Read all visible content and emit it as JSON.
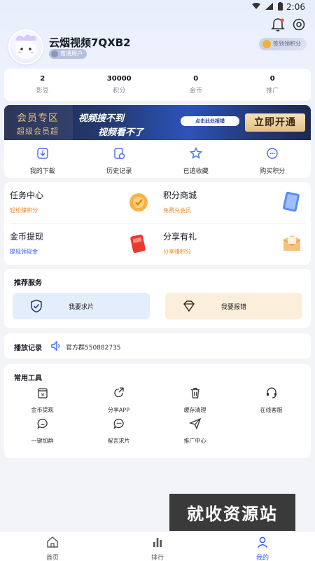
{
  "status_bar": {
    "time": "2:06"
  },
  "profile": {
    "username": "云烟视频7QXB2",
    "user_badge": "普通用户",
    "signin_label": "签到领积分"
  },
  "stats": [
    {
      "value": "2",
      "label": "影豆"
    },
    {
      "value": "30000",
      "label": "积分"
    },
    {
      "value": "0",
      "label": "金币"
    },
    {
      "value": "0",
      "label": "推广"
    }
  ],
  "vip_banner": {
    "zone_title": "会员专区",
    "zone_subtitle": "超级会员超",
    "slogan_1": "视频搜不到",
    "slogan_2": "视频看不了",
    "report_pill": "点击此处报错",
    "open_button": "立即开通"
  },
  "quick_actions": [
    {
      "label": "我的下载",
      "icon": "download-icon"
    },
    {
      "label": "历史记录",
      "icon": "history-icon"
    },
    {
      "label": "已追收藏",
      "icon": "star-icon"
    },
    {
      "label": "购买积分",
      "icon": "coin-icon"
    }
  ],
  "tasks": [
    {
      "title": "任务中心",
      "subtitle": "轻松赚积分",
      "icon": "task-center-icon",
      "color": "#f08a24"
    },
    {
      "title": "积分商城",
      "subtitle": "免费兑会员",
      "icon": "points-mall-icon",
      "color": "#f08a24"
    },
    {
      "title": "金币提现",
      "subtitle": "提现领现金",
      "icon": "coin-withdraw-icon",
      "color": "#2d5bf0"
    },
    {
      "title": "分享有礼",
      "subtitle": "分享赚积分",
      "icon": "share-gift-icon",
      "color": "#f08a24"
    }
  ],
  "recommend": {
    "title": "推荐服务",
    "request_label": "我要求片",
    "report_label": "我要报错"
  },
  "play_record": {
    "title": "播放记录",
    "group": "官方群550882735"
  },
  "tools": {
    "title": "常用工具",
    "items": [
      {
        "label": "金币提现",
        "icon": "wallet-icon"
      },
      {
        "label": "分享APP",
        "icon": "share-icon"
      },
      {
        "label": "缓存清理",
        "icon": "trash-icon"
      },
      {
        "label": "在线客服",
        "icon": "headset-icon"
      },
      {
        "label": "一键加群",
        "icon": "chat-icon"
      },
      {
        "label": "留言求片",
        "icon": "message-icon"
      },
      {
        "label": "推广中心",
        "icon": "send-icon"
      }
    ]
  },
  "watermark": "就收资源站",
  "tabbar": [
    {
      "label": "首页",
      "icon": "home-icon",
      "active": false
    },
    {
      "label": "排行",
      "icon": "ranking-icon",
      "active": false
    },
    {
      "label": "我的",
      "icon": "user-icon",
      "active": true
    }
  ],
  "colors": {
    "accent": "#2d5bf0",
    "orange": "#f08a24",
    "vip_gold": "#e6c38d"
  }
}
